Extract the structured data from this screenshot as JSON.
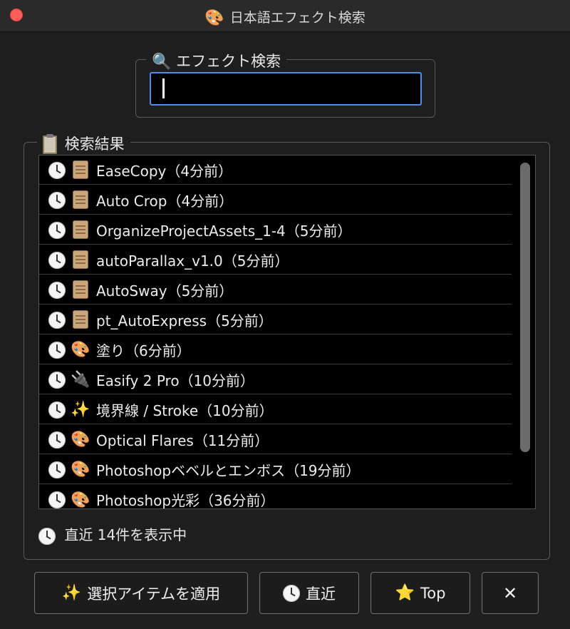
{
  "window": {
    "title": "日本語エフェクト検索",
    "title_icon": "palette-icon"
  },
  "search": {
    "legend": "エフェクト検索",
    "legend_icon": "magnifier-icon",
    "value": ""
  },
  "results": {
    "legend": "検索結果",
    "legend_icon": "clipboard-icon",
    "items": [
      {
        "icon": "scroll-icon",
        "label": "EaseCopy（4分前）"
      },
      {
        "icon": "scroll-icon",
        "label": "Auto Crop（4分前）"
      },
      {
        "icon": "scroll-icon",
        "label": "OrganizeProjectAssets_1-4（5分前）"
      },
      {
        "icon": "scroll-icon",
        "label": "autoParallax_v1.0（5分前）"
      },
      {
        "icon": "scroll-icon",
        "label": "AutoSway（5分前）"
      },
      {
        "icon": "scroll-icon",
        "label": "pt_AutoExpress（5分前）"
      },
      {
        "icon": "palette-icon",
        "label": "塗り（6分前）"
      },
      {
        "icon": "plug-icon",
        "label": "Easify 2 Pro（10分前）"
      },
      {
        "icon": "sparkles-icon",
        "label": "境界線 / Stroke（10分前）"
      },
      {
        "icon": "palette-icon",
        "label": "Optical Flares（11分前）"
      },
      {
        "icon": "palette-icon",
        "label": "Photoshopベベルとエンボス（19分前）"
      },
      {
        "icon": "palette-icon",
        "label": "Photoshop光彩（36分前）"
      }
    ],
    "status": "直近 14件を表示中"
  },
  "buttons": {
    "apply": "選択アイテムを適用",
    "recent": "直近",
    "top": "Top",
    "close": "✕"
  },
  "colors": {
    "accent": "#4d8fe6",
    "close_dot": "#ff5f57"
  }
}
